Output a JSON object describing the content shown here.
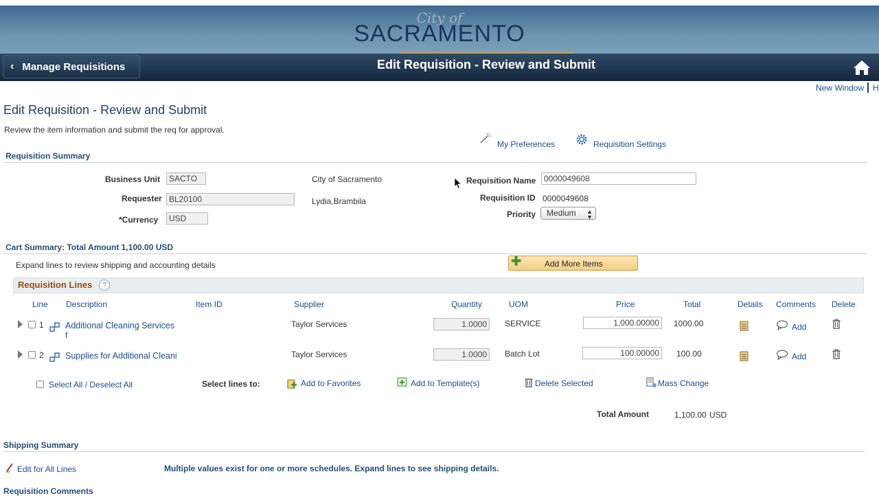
{
  "banner": {
    "logo_top": "City of",
    "logo_main": "SACRAMENTO"
  },
  "nav": {
    "back_label": "Manage Requisitions",
    "title": "Edit Requisition  - Review and Submit"
  },
  "toplinks": {
    "new_window": "New Window",
    "help": "H"
  },
  "page": {
    "title": "Edit Requisition  - Review and Submit",
    "instruction": "Review the item information and submit the req for approval.",
    "my_preferences": "My Preferences",
    "requisition_settings": "Requisition Settings"
  },
  "summary": {
    "heading": "Requisition Summary",
    "business_unit_label": "Business Unit",
    "business_unit": "SACTO",
    "business_unit_desc": "City of Sacramento",
    "requester_label": "Requester",
    "requester": "BL20100",
    "requester_name": "Lydia,Brambila",
    "currency_label": "*Currency",
    "currency": "USD",
    "req_name_label": "Requisition Name",
    "req_name": "0000049608",
    "req_id_label": "Requisition ID",
    "req_id": "0000049608",
    "priority_label": "Priority",
    "priority": "Medium"
  },
  "cart": {
    "heading": "Cart Summary: Total Amount 1,100.00 USD",
    "expand_note": "Expand lines to review shipping and accounting details",
    "add_more": "Add More Items",
    "lines_heading": "Requisition Lines",
    "help_glyph": "?"
  },
  "table": {
    "columns": [
      "Line",
      "Description",
      "Item ID",
      "Supplier",
      "Quantity",
      "UOM",
      "Price",
      "Total",
      "Details",
      "Comments",
      "Delete"
    ],
    "rows": [
      {
        "line": "1",
        "description": "Additional Cleaning Services",
        "description_cont": "f",
        "supplier": "Taylor Services",
        "quantity": "1.0000",
        "uom": "SERVICE",
        "price": "1,000.00000",
        "total": "1000.00",
        "comment": "Add"
      },
      {
        "line": "2",
        "description": "Supplies for Additional Cleani",
        "description_cont": "",
        "supplier": "Taylor Services",
        "quantity": "1.0000",
        "uom": "Batch Lot",
        "price": "100.00000",
        "total": "100.00",
        "comment": "Add"
      }
    ]
  },
  "actions": {
    "select_all": "Select All / Deselect All",
    "select_lines_to": "Select lines to:",
    "add_favorites": "Add to Favorites",
    "add_template": "Add to Template(s)",
    "delete_selected": "Delete Selected",
    "mass_change": "Mass Change"
  },
  "totals": {
    "label": "Total Amount",
    "value": "1,100.00",
    "currency": "USD"
  },
  "shipping": {
    "heading": "Shipping Summary",
    "edit_all": "Edit for All Lines",
    "note": "Multiple values exist for one or more schedules. Expand lines to see shipping details."
  },
  "comments": {
    "heading": "Requisition Comments"
  },
  "colors": {
    "banner": "#5b86a8",
    "nav": "#1f3650",
    "link": "#1a4d8c",
    "add_more_bg": "#f8dba0"
  }
}
